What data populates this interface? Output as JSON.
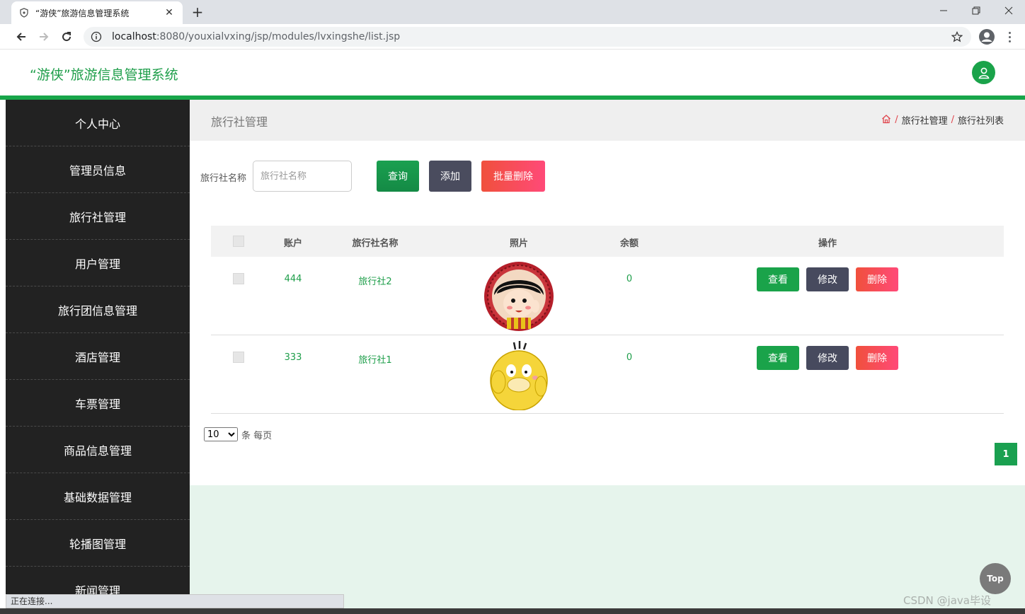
{
  "browser": {
    "tab_title": "“游侠”旅游信息管理系统",
    "tab_close": "✕",
    "new_tab": "+",
    "url_host": "localhost",
    "url_rest": ":8080/youxialvxing/jsp/modules/lvxingshe/list.jsp",
    "status_text": "正在连接..."
  },
  "app": {
    "title": "“游侠”旅游信息管理系统"
  },
  "sidebar": {
    "items": [
      {
        "label": "个人中心"
      },
      {
        "label": "管理员信息"
      },
      {
        "label": "旅行社管理"
      },
      {
        "label": "用户管理"
      },
      {
        "label": "旅行团信息管理"
      },
      {
        "label": "酒店管理"
      },
      {
        "label": "车票管理"
      },
      {
        "label": "商品信息管理"
      },
      {
        "label": "基础数据管理"
      },
      {
        "label": "轮播图管理"
      },
      {
        "label": "新闻管理"
      }
    ]
  },
  "page": {
    "title": "旅行社管理",
    "breadcrumb": [
      "旅行社管理",
      "旅行社列表"
    ],
    "breadcrumb_sep": "/"
  },
  "search": {
    "label": "旅行社名称",
    "placeholder": "旅行社名称",
    "query_label": "查询",
    "add_label": "添加",
    "batch_delete_label": "批量删除"
  },
  "table": {
    "headers": {
      "account": "账户",
      "name": "旅行社名称",
      "photo": "照片",
      "balance": "余额",
      "actions": "操作"
    },
    "rows": [
      {
        "account": "444",
        "name": "旅行社2",
        "balance": "0",
        "photo": "cartoon-girl"
      },
      {
        "account": "333",
        "name": "旅行社1",
        "balance": "0",
        "photo": "yellow-duck"
      }
    ],
    "view_label": "查看",
    "edit_label": "修改",
    "delete_label": "删除"
  },
  "pagination": {
    "page_size": "10",
    "page_size_options": [
      "10"
    ],
    "per_page_text": "条 每页",
    "current_page": "1"
  },
  "top_button": "Top",
  "watermark": "CSDN @java毕设",
  "colors": {
    "brand_green": "#1aa34a",
    "sidebar_bg": "#222222",
    "danger": "#f0503c",
    "dark_btn": "#4a4c5e"
  }
}
